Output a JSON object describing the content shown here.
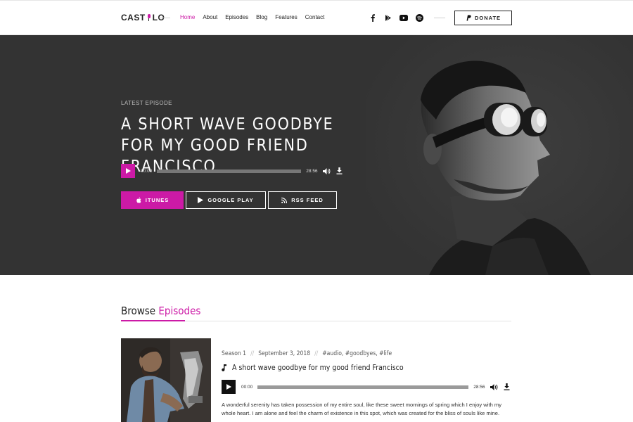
{
  "header": {
    "logo_left": "CAST",
    "logo_right": "LO",
    "nav": [
      "Home",
      "About",
      "Episodes",
      "Blog",
      "Features",
      "Contact"
    ],
    "social_icons": [
      "facebook-icon",
      "google-play-icon",
      "youtube-icon",
      "spotify-icon"
    ],
    "donate_label": "DONATE"
  },
  "hero": {
    "eyebrow": "LATEST EPISODE",
    "title": "A SHORT WAVE GOODBYE FOR MY GOOD FRIEND FRANCISCO",
    "player": {
      "current_time": "00:00",
      "duration": "28:56",
      "progress": 0
    },
    "buttons": {
      "itunes": "ITUNES",
      "google_play": "GOOGLE PLAY",
      "rss": "RSS FEED"
    }
  },
  "browse": {
    "title_plain": "Browse",
    "title_accent": "Episodes"
  },
  "episode": {
    "season": "Season 1",
    "date": "September 3, 2018",
    "tags": "#audio, #goodbyes, #life",
    "title": "A short wave goodbye for my good friend Francisco",
    "player": {
      "current_time": "00:00",
      "duration": "28:56",
      "progress": 0
    },
    "description": "A wonderful serenity has taken possession of my entire soul, like these sweet mornings of spring which I enjoy with my whole heart. I am alone and feel the charm of existence in this spot, which was created for the bliss of souls like mine."
  },
  "colors": {
    "accent": "#cc1aa6",
    "hero_bg": "#333333",
    "text": "#222222"
  }
}
